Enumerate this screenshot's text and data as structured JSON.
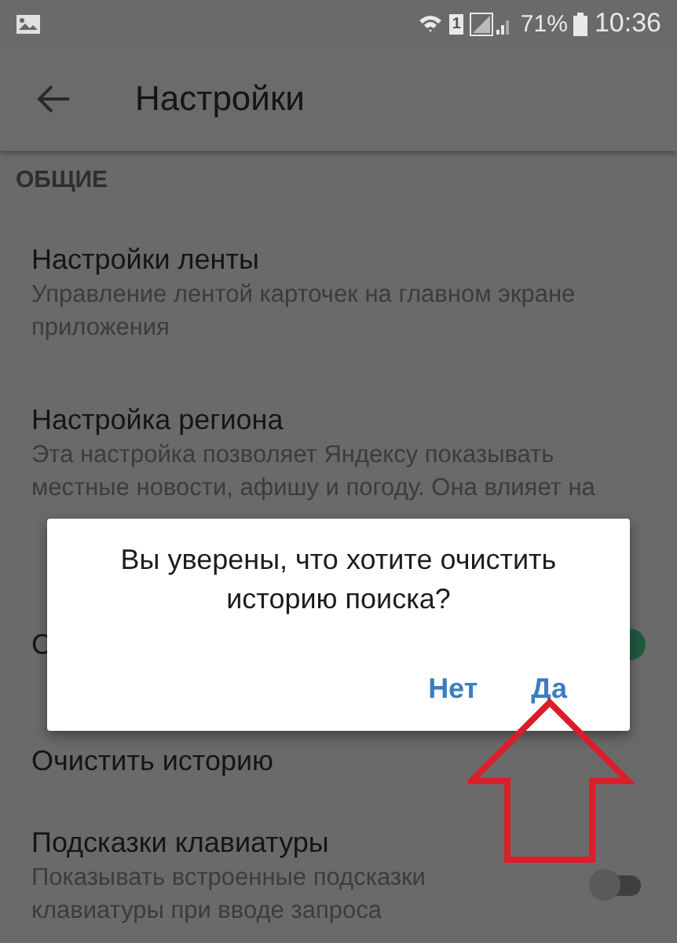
{
  "status_bar": {
    "battery": "71%",
    "time": "10:36",
    "sim": "1"
  },
  "app_bar": {
    "title": "Настройки"
  },
  "section": {
    "title": "ОБЩИЕ"
  },
  "items": [
    {
      "kind": "text",
      "title": "Настройки ленты",
      "description": "Управление лентой карточек на главном экране приложения"
    },
    {
      "kind": "text",
      "title": "Настройка региона",
      "description": "Эта настройка позволяет Яндексу показывать местные новости, афишу и погоду. Она влияет на"
    },
    {
      "kind": "toggle",
      "title": "С",
      "on": true
    },
    {
      "kind": "text",
      "title": "Очистить историю"
    },
    {
      "kind": "toggle",
      "title": "Подсказки клавиатуры",
      "description": "Показывать встроенные подсказки клавиатуры при вводе запроса",
      "on": false
    }
  ],
  "dialog": {
    "message": "Вы уверены, что хотите очистить историю поиска?",
    "buttons": [
      "Нет",
      "Да"
    ]
  }
}
